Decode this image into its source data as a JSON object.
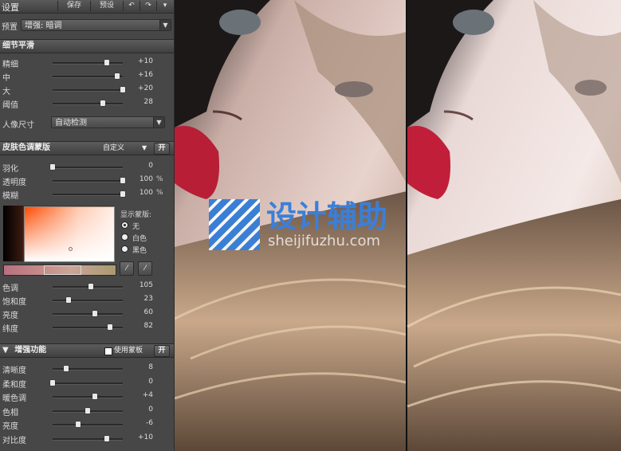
{
  "toolbar": {
    "title": "设置",
    "save": "保存",
    "preset": "预设",
    "undo_icon": "undo-icon",
    "redo_icon": "redo-icon"
  },
  "preset_row": {
    "label": "预置",
    "value": "增强: 暗调"
  },
  "detail_smoothing": {
    "title": "细节平滑",
    "sliders": [
      {
        "label": "精细",
        "value": "+10",
        "level": 0.77
      },
      {
        "label": "中",
        "value": "+16",
        "level": 0.92
      },
      {
        "label": "大",
        "value": "+20",
        "level": 1.0
      },
      {
        "label": "阈值",
        "value": "28",
        "level": 0.72
      }
    ],
    "portrait_size": {
      "label": "人像尺寸",
      "value": "自动检测"
    }
  },
  "skin_mask": {
    "title": "皮肤色调蒙版",
    "mode": "自定义",
    "on_label": "开",
    "sliders": [
      {
        "label": "羽化",
        "value": "0",
        "unit": "",
        "level": 0.0
      },
      {
        "label": "透明度",
        "value": "100",
        "unit": "%",
        "level": 1.0
      },
      {
        "label": "模糊",
        "value": "100",
        "unit": "%",
        "level": 1.0
      }
    ],
    "display_mask": {
      "label": "显示蒙版:",
      "options": [
        "无",
        "白色",
        "黑色"
      ],
      "selected": 0
    },
    "colors": {
      "hue_base": "#ff4a00"
    },
    "hsl_sliders": [
      {
        "label": "色调",
        "value": "105",
        "level": 0.55
      },
      {
        "label": "饱和度",
        "value": "23",
        "level": 0.23
      },
      {
        "label": "亮度",
        "value": "60",
        "level": 0.6
      },
      {
        "label": "纬度",
        "value": "82",
        "level": 0.82
      }
    ]
  },
  "enhance": {
    "title": "增强功能",
    "use_mask": "使用蒙板",
    "on_label": "开",
    "sliders": [
      {
        "label": "清晰度",
        "value": "8",
        "level": 0.19
      },
      {
        "label": "柔和度",
        "value": "0",
        "level": 0.0
      },
      {
        "label": "暖色调",
        "value": "+4",
        "level": 0.6
      },
      {
        "label": "色相",
        "value": "0",
        "level": 0.5
      },
      {
        "label": "亮度",
        "value": "-6",
        "level": 0.36
      },
      {
        "label": "对比度",
        "value": "+10",
        "level": 0.77
      }
    ]
  },
  "watermark": {
    "title": "设计辅助",
    "url": "sheijifuzhu.com"
  }
}
